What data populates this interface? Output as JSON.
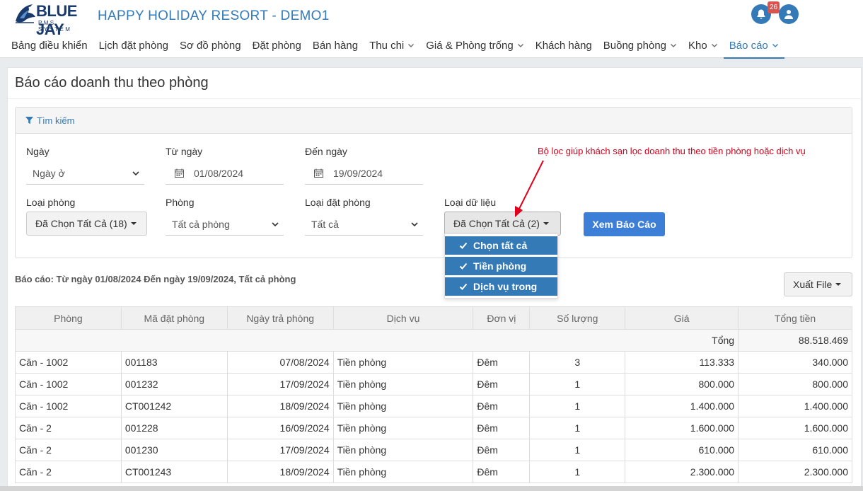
{
  "brand": {
    "logo_main": "BLUE JAY",
    "logo_sub": "PMS SYSTEM",
    "hotel_name": "HAPPY HOLIDAY RESORT - DEMO1"
  },
  "header": {
    "notification_count": "26"
  },
  "nav": [
    {
      "label": "Bảng điều khiển",
      "has_dropdown": false
    },
    {
      "label": "Lịch đặt phòng",
      "has_dropdown": false
    },
    {
      "label": "Sơ đồ phòng",
      "has_dropdown": false
    },
    {
      "label": "Đặt phòng",
      "has_dropdown": false
    },
    {
      "label": "Bán hàng",
      "has_dropdown": false
    },
    {
      "label": "Thu chi",
      "has_dropdown": true
    },
    {
      "label": "Giá & Phòng trống",
      "has_dropdown": true
    },
    {
      "label": "Khách hàng",
      "has_dropdown": false
    },
    {
      "label": "Buồng phòng",
      "has_dropdown": true
    },
    {
      "label": "Kho",
      "has_dropdown": true
    },
    {
      "label": "Báo cáo",
      "has_dropdown": true,
      "active": true
    }
  ],
  "page": {
    "title": "Báo cáo doanh thu theo phòng"
  },
  "search": {
    "header": "Tìm kiếm",
    "date_type": {
      "label": "Ngày",
      "value": "Ngày ở"
    },
    "from_date": {
      "label": "Từ ngày",
      "value": "01/08/2024"
    },
    "to_date": {
      "label": "Đến ngày",
      "value": "19/09/2024"
    },
    "room_type": {
      "label": "Loại phòng",
      "value": "Đã Chọn Tất Cả (18)"
    },
    "room": {
      "label": "Phòng",
      "value": "Tất cả phòng"
    },
    "booking_type": {
      "label": "Loại đặt phòng",
      "value": "Tất cả"
    },
    "data_type": {
      "label": "Loại dữ liệu",
      "value": "Đã Chọn Tất Cả (2)",
      "options": [
        "Chọn tất cả",
        "Tiền phòng",
        "Dịch vụ trong"
      ]
    },
    "submit_label": "Xem Báo Cáo"
  },
  "annotation": "Bộ lọc giúp khách sạn lọc doanh thu theo tiền phòng hoặc dịch vụ",
  "report": {
    "summary_line": "Báo cáo: Từ ngày 01/08/2024 Đến ngày 19/09/2024, Tất cả phòng",
    "export_label": "Xuất File"
  },
  "table": {
    "columns": [
      "Phòng",
      "Mã đặt phòng",
      "Ngày trả phòng",
      "Dịch vụ",
      "Đơn vị",
      "Số lượng",
      "Giá",
      "Tổng tiền"
    ],
    "total_label": "Tổng",
    "total_value": "88.518.469",
    "rows": [
      [
        "Căn - 1002",
        "001183",
        "07/08/2024",
        "Tiền phòng",
        "Đêm",
        "3",
        "113.333",
        "340.000"
      ],
      [
        "Căn - 1002",
        "001232",
        "17/09/2024",
        "Tiền phòng",
        "Đêm",
        "1",
        "800.000",
        "800.000"
      ],
      [
        "Căn - 1002",
        "CT001242",
        "18/09/2024",
        "Tiền phòng",
        "Đêm",
        "1",
        "1.400.000",
        "1.400.000"
      ],
      [
        "Căn - 2",
        "001228",
        "16/09/2024",
        "Tiền phòng",
        "Đêm",
        "1",
        "1.600.000",
        "1.600.000"
      ],
      [
        "Căn - 2",
        "001230",
        "17/09/2024",
        "Tiền phòng",
        "Đêm",
        "1",
        "610.000",
        "610.000"
      ],
      [
        "Căn - 2",
        "CT001243",
        "18/09/2024",
        "Tiền phòng",
        "Đêm",
        "1",
        "2.300.000",
        "2.300.000"
      ]
    ]
  },
  "colors": {
    "primary": "#337ab7",
    "button": "#3d7fd6",
    "annotation": "#d0021b",
    "badge": "#d9534f"
  }
}
